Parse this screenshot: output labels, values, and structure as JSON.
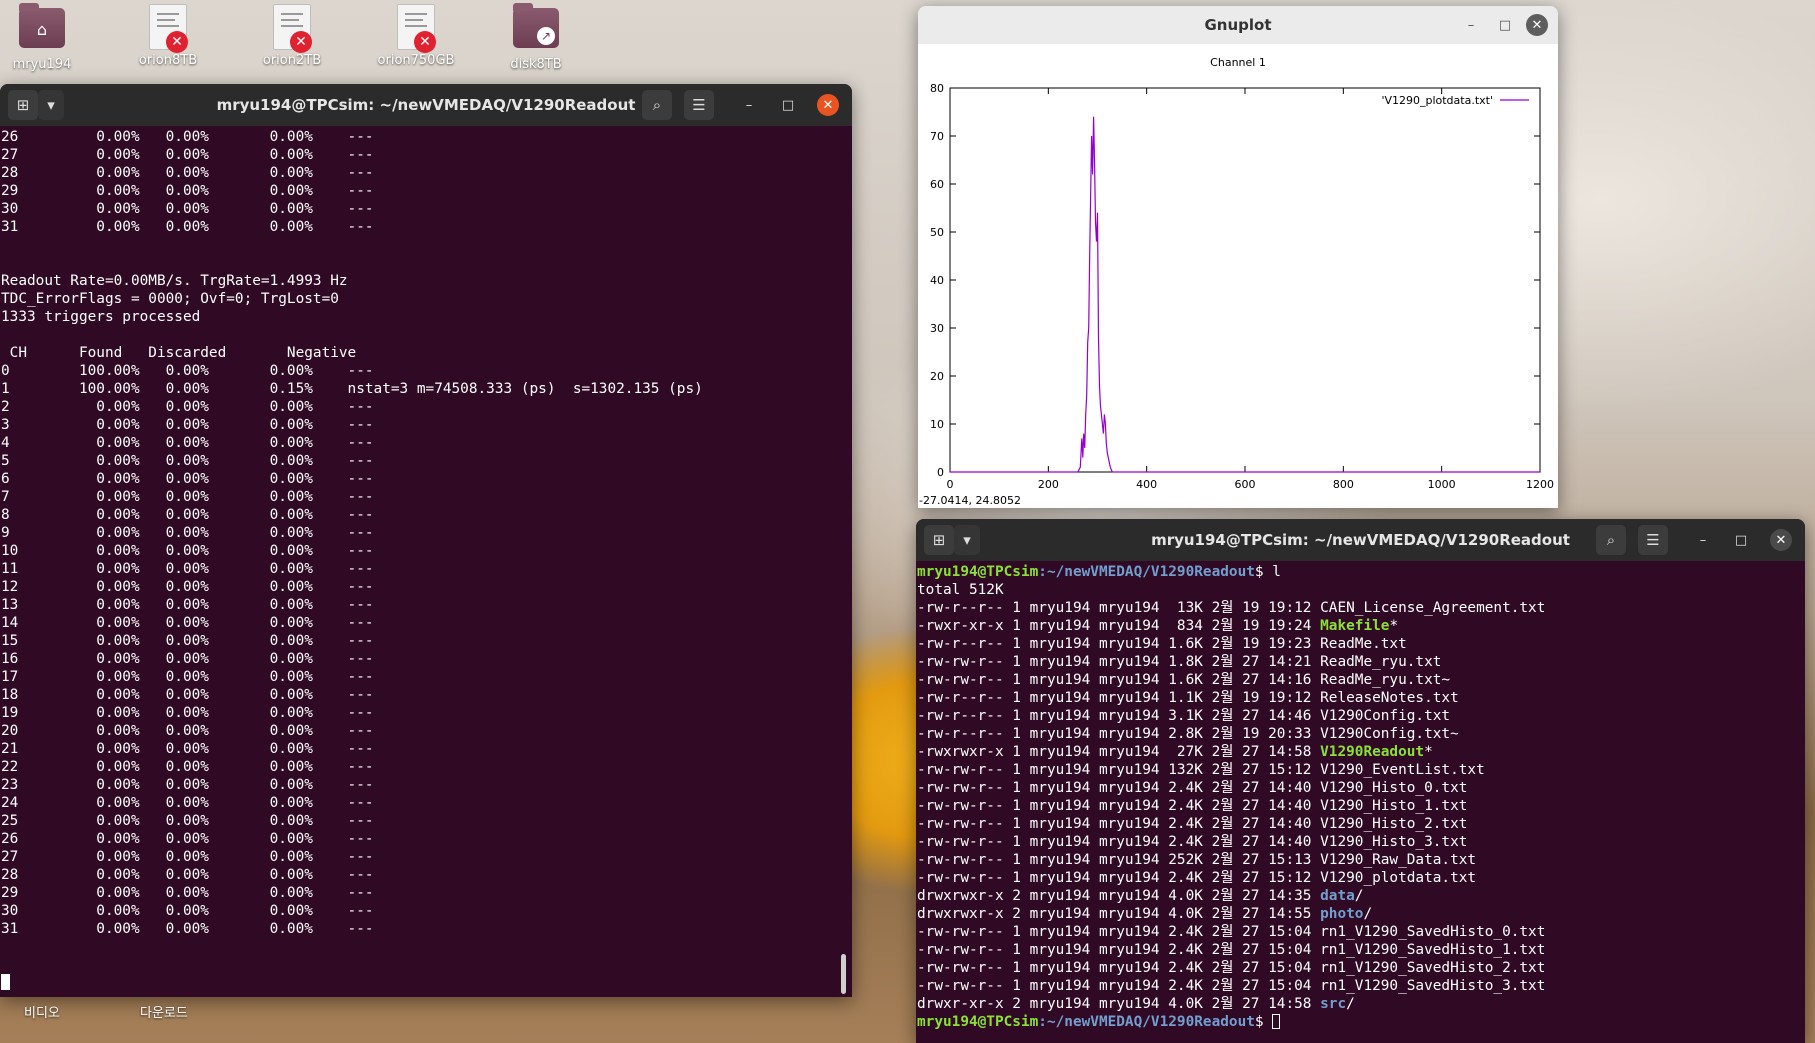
{
  "desktop": {
    "icons": [
      {
        "label": "mryu194",
        "kind": "home-folder"
      },
      {
        "label": "orion8TB",
        "kind": "drive-error"
      },
      {
        "label": "orion2TB",
        "kind": "drive-error"
      },
      {
        "label": "orion750GB",
        "kind": "drive-error"
      },
      {
        "label": "disk8TB",
        "kind": "link-folder"
      }
    ],
    "bottom_labels": [
      "비디오",
      "다운로드"
    ]
  },
  "terminal_left": {
    "title": "mryu194@TPCsim: ~/newVMEDAQ/V1290Readout",
    "top_rows": [
      [
        "26",
        "0.00%",
        "0.00%",
        "0.00%",
        "---"
      ],
      [
        "27",
        "0.00%",
        "0.00%",
        "0.00%",
        "---"
      ],
      [
        "28",
        "0.00%",
        "0.00%",
        "0.00%",
        "---"
      ],
      [
        "29",
        "0.00%",
        "0.00%",
        "0.00%",
        "---"
      ],
      [
        "30",
        "0.00%",
        "0.00%",
        "0.00%",
        "---"
      ],
      [
        "31",
        "0.00%",
        "0.00%",
        "0.00%",
        "---"
      ]
    ],
    "status": [
      "Readout Rate=0.00MB/s. TrgRate=1.4993 Hz",
      "TDC_ErrorFlags = 0000; Ovf=0; TrgLost=0",
      "1333 triggers processed"
    ],
    "header": [
      "CH",
      "Found",
      "Discarded",
      "Negative"
    ],
    "rows": [
      [
        "0",
        "100.00%",
        "0.00%",
        "0.00%",
        "---"
      ],
      [
        "1",
        "100.00%",
        "0.00%",
        "0.15%",
        "nstat=3 m=74508.333 (ps)  s=1302.135 (ps)"
      ],
      [
        "2",
        "0.00%",
        "0.00%",
        "0.00%",
        "---"
      ],
      [
        "3",
        "0.00%",
        "0.00%",
        "0.00%",
        "---"
      ],
      [
        "4",
        "0.00%",
        "0.00%",
        "0.00%",
        "---"
      ],
      [
        "5",
        "0.00%",
        "0.00%",
        "0.00%",
        "---"
      ],
      [
        "6",
        "0.00%",
        "0.00%",
        "0.00%",
        "---"
      ],
      [
        "7",
        "0.00%",
        "0.00%",
        "0.00%",
        "---"
      ],
      [
        "8",
        "0.00%",
        "0.00%",
        "0.00%",
        "---"
      ],
      [
        "9",
        "0.00%",
        "0.00%",
        "0.00%",
        "---"
      ],
      [
        "10",
        "0.00%",
        "0.00%",
        "0.00%",
        "---"
      ],
      [
        "11",
        "0.00%",
        "0.00%",
        "0.00%",
        "---"
      ],
      [
        "12",
        "0.00%",
        "0.00%",
        "0.00%",
        "---"
      ],
      [
        "13",
        "0.00%",
        "0.00%",
        "0.00%",
        "---"
      ],
      [
        "14",
        "0.00%",
        "0.00%",
        "0.00%",
        "---"
      ],
      [
        "15",
        "0.00%",
        "0.00%",
        "0.00%",
        "---"
      ],
      [
        "16",
        "0.00%",
        "0.00%",
        "0.00%",
        "---"
      ],
      [
        "17",
        "0.00%",
        "0.00%",
        "0.00%",
        "---"
      ],
      [
        "18",
        "0.00%",
        "0.00%",
        "0.00%",
        "---"
      ],
      [
        "19",
        "0.00%",
        "0.00%",
        "0.00%",
        "---"
      ],
      [
        "20",
        "0.00%",
        "0.00%",
        "0.00%",
        "---"
      ],
      [
        "21",
        "0.00%",
        "0.00%",
        "0.00%",
        "---"
      ],
      [
        "22",
        "0.00%",
        "0.00%",
        "0.00%",
        "---"
      ],
      [
        "23",
        "0.00%",
        "0.00%",
        "0.00%",
        "---"
      ],
      [
        "24",
        "0.00%",
        "0.00%",
        "0.00%",
        "---"
      ],
      [
        "25",
        "0.00%",
        "0.00%",
        "0.00%",
        "---"
      ],
      [
        "26",
        "0.00%",
        "0.00%",
        "0.00%",
        "---"
      ],
      [
        "27",
        "0.00%",
        "0.00%",
        "0.00%",
        "---"
      ],
      [
        "28",
        "0.00%",
        "0.00%",
        "0.00%",
        "---"
      ],
      [
        "29",
        "0.00%",
        "0.00%",
        "0.00%",
        "---"
      ],
      [
        "30",
        "0.00%",
        "0.00%",
        "0.00%",
        "---"
      ],
      [
        "31",
        "0.00%",
        "0.00%",
        "0.00%",
        "---"
      ]
    ]
  },
  "gnuplot": {
    "title": "Gnuplot",
    "mouse_readout": "-27.0414,  24.8052",
    "chart_data": {
      "type": "line",
      "title": "Channel 1",
      "legend": "'V1290_plotdata.txt'",
      "legend_position": "top-right",
      "xlim": [
        0,
        1200
      ],
      "ylim": [
        0,
        80
      ],
      "xticks": [
        0,
        200,
        400,
        600,
        800,
        1000,
        1200
      ],
      "yticks": [
        0,
        10,
        20,
        30,
        40,
        50,
        60,
        70,
        80
      ],
      "series_color": "#9400d3",
      "x": [
        0,
        260,
        265,
        268,
        270,
        272,
        274,
        276,
        278,
        280,
        282,
        284,
        286,
        288,
        290,
        292,
        294,
        296,
        298,
        300,
        302,
        304,
        306,
        308,
        310,
        312,
        314,
        316,
        318,
        320,
        322,
        324,
        326,
        330,
        1200
      ],
      "y": [
        0,
        0,
        1,
        7,
        3,
        8,
        5,
        12,
        16,
        27,
        30,
        44,
        57,
        70,
        62,
        74,
        64,
        52,
        48,
        54,
        28,
        18,
        14,
        12,
        10,
        8,
        12,
        10,
        6,
        4,
        3,
        2,
        1,
        0,
        0
      ]
    }
  },
  "terminal_right": {
    "title": "mryu194@TPCsim: ~/newVMEDAQ/V1290Readout",
    "prompt_user": "mryu194@TPCsim",
    "prompt_path": ":~/newVMEDAQ/V1290Readout",
    "prompt_suffix": "$ ",
    "command": "l",
    "total": "total 512K",
    "files": [
      {
        "perm": "-rw-r--r--",
        "size": " 13K",
        "day": "19",
        "time": "19:12",
        "name": "CAEN_License_Agreement.txt",
        "type": "file"
      },
      {
        "perm": "-rwxr-xr-x",
        "size": " 834",
        "day": "19",
        "time": "19:24",
        "name": "Makefile",
        "type": "exe"
      },
      {
        "perm": "-rw-r--r--",
        "size": "1.6K",
        "day": "19",
        "time": "19:23",
        "name": "ReadMe.txt",
        "type": "file"
      },
      {
        "perm": "-rw-rw-r--",
        "size": "1.8K",
        "day": "27",
        "time": "14:21",
        "name": "ReadMe_ryu.txt",
        "type": "file"
      },
      {
        "perm": "-rw-rw-r--",
        "size": "1.6K",
        "day": "27",
        "time": "14:16",
        "name": "ReadMe_ryu.txt~",
        "type": "file"
      },
      {
        "perm": "-rw-r--r--",
        "size": "1.1K",
        "day": "19",
        "time": "19:12",
        "name": "ReleaseNotes.txt",
        "type": "file"
      },
      {
        "perm": "-rw-r--r--",
        "size": "3.1K",
        "day": "27",
        "time": "14:46",
        "name": "V1290Config.txt",
        "type": "file"
      },
      {
        "perm": "-rw-r--r--",
        "size": "2.8K",
        "day": "19",
        "time": "20:33",
        "name": "V1290Config.txt~",
        "type": "file"
      },
      {
        "perm": "-rwxrwxr-x",
        "size": " 27K",
        "day": "27",
        "time": "14:58",
        "name": "V1290Readout",
        "type": "exe"
      },
      {
        "perm": "-rw-rw-r--",
        "size": "132K",
        "day": "27",
        "time": "15:12",
        "name": "V1290_EventList.txt",
        "type": "file"
      },
      {
        "perm": "-rw-rw-r--",
        "size": "2.4K",
        "day": "27",
        "time": "14:40",
        "name": "V1290_Histo_0.txt",
        "type": "file"
      },
      {
        "perm": "-rw-rw-r--",
        "size": "2.4K",
        "day": "27",
        "time": "14:40",
        "name": "V1290_Histo_1.txt",
        "type": "file"
      },
      {
        "perm": "-rw-rw-r--",
        "size": "2.4K",
        "day": "27",
        "time": "14:40",
        "name": "V1290_Histo_2.txt",
        "type": "file"
      },
      {
        "perm": "-rw-rw-r--",
        "size": "2.4K",
        "day": "27",
        "time": "14:40",
        "name": "V1290_Histo_3.txt",
        "type": "file"
      },
      {
        "perm": "-rw-rw-r--",
        "size": "252K",
        "day": "27",
        "time": "15:13",
        "name": "V1290_Raw_Data.txt",
        "type": "file"
      },
      {
        "perm": "-rw-rw-r--",
        "size": "2.4K",
        "day": "27",
        "time": "15:12",
        "name": "V1290_plotdata.txt",
        "type": "file"
      },
      {
        "perm": "drwxrwxr-x",
        "size": "4.0K",
        "day": "27",
        "time": "14:35",
        "name": "data",
        "type": "dir"
      },
      {
        "perm": "drwxrwxr-x",
        "size": "4.0K",
        "day": "27",
        "time": "14:55",
        "name": "photo",
        "type": "dir"
      },
      {
        "perm": "-rw-rw-r--",
        "size": "2.4K",
        "day": "27",
        "time": "15:04",
        "name": "rn1_V1290_SavedHisto_0.txt",
        "type": "file"
      },
      {
        "perm": "-rw-rw-r--",
        "size": "2.4K",
        "day": "27",
        "time": "15:04",
        "name": "rn1_V1290_SavedHisto_1.txt",
        "type": "file"
      },
      {
        "perm": "-rw-rw-r--",
        "size": "2.4K",
        "day": "27",
        "time": "15:04",
        "name": "rn1_V1290_SavedHisto_2.txt",
        "type": "file"
      },
      {
        "perm": "-rw-rw-r--",
        "size": "2.4K",
        "day": "27",
        "time": "15:04",
        "name": "rn1_V1290_SavedHisto_3.txt",
        "type": "file"
      },
      {
        "perm": "drwxr-xr-x",
        "size": "4.0K",
        "day": "27",
        "time": "14:58",
        "name": "src",
        "type": "dir"
      }
    ],
    "owner": "mryu194",
    "group": "mryu194",
    "links": [
      "1",
      "1",
      "1",
      "1",
      "1",
      "1",
      "1",
      "1",
      "1",
      "1",
      "1",
      "1",
      "1",
      "1",
      "1",
      "1",
      "2",
      "2",
      "1",
      "1",
      "1",
      "1",
      "2"
    ],
    "month": "2월"
  },
  "icons": {
    "new_tab": "new-tab-icon",
    "menu_down": "chevron-down-icon",
    "search": "search-icon",
    "hamburger": "hamburger-menu-icon",
    "minimize": "minimize-icon",
    "maximize": "maximize-icon",
    "close": "close-icon"
  }
}
